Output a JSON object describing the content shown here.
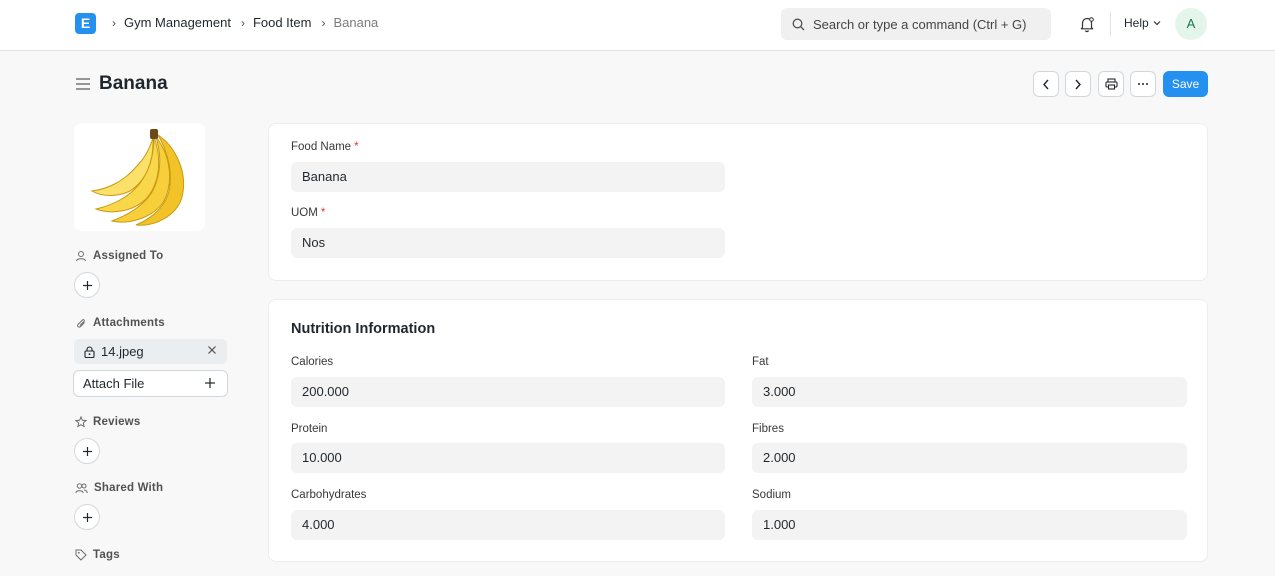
{
  "navbar": {
    "logo_letter": "E",
    "breadcrumbs": [
      "Gym Management",
      "Food Item",
      "Banana"
    ],
    "search_placeholder": "Search or type a command (Ctrl + G)",
    "help_label": "Help",
    "avatar_initial": "A"
  },
  "page": {
    "title": "Banana",
    "save_label": "Save"
  },
  "sidebar": {
    "assigned_to_label": "Assigned To",
    "attachments_label": "Attachments",
    "attachment_name": "14.jpeg",
    "attach_file_label": "Attach File",
    "reviews_label": "Reviews",
    "shared_with_label": "Shared With",
    "tags_label": "Tags"
  },
  "form": {
    "food_name_label": "Food Name",
    "food_name_value": "Banana",
    "uom_label": "UOM",
    "uom_value": "Nos",
    "required_mark": "*"
  },
  "nutrition": {
    "section_title": "Nutrition Information",
    "calories_label": "Calories",
    "calories_value": "200.000",
    "protein_label": "Protein",
    "protein_value": "10.000",
    "carbohydrates_label": "Carbohydrates",
    "carbohydrates_value": "4.000",
    "fat_label": "Fat",
    "fat_value": "3.000",
    "fibres_label": "Fibres",
    "fibres_value": "2.000",
    "sodium_label": "Sodium",
    "sodium_value": "1.000"
  },
  "colors": {
    "primary": "#2490ef",
    "required": "#e03636",
    "avatar_bg": "#e4f5e9"
  }
}
